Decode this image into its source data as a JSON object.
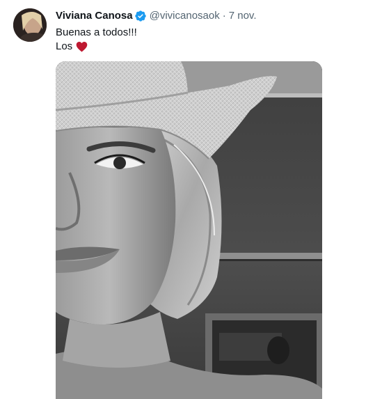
{
  "tweet": {
    "author": {
      "display_name": "Viviana Canosa",
      "handle": "@vivicanosaok",
      "verified": true,
      "avatar_icon": "profile-photo"
    },
    "separator": "·",
    "timestamp": "7 nov.",
    "text_line_1": "Buenas a todos!!!",
    "text_line_2": "Los",
    "emoji": "heart-icon",
    "colors": {
      "verified_blue": "#1d9bf0",
      "heart_red": "#be1931",
      "muted_text": "#536471",
      "primary_text": "#0f1419"
    }
  }
}
